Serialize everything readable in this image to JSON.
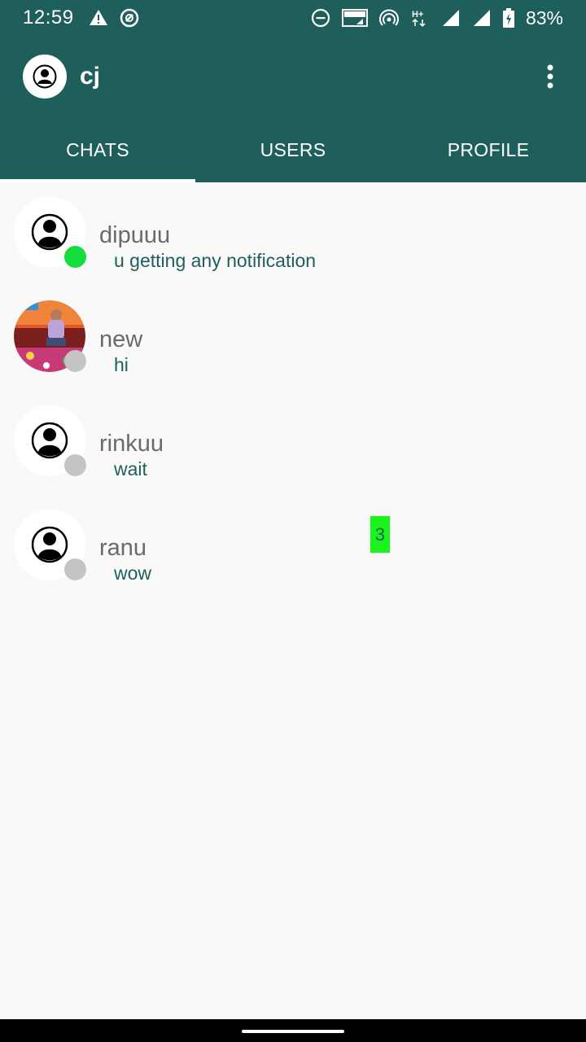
{
  "status_bar": {
    "time": "12:59",
    "battery": "83%",
    "left_icons": [
      "warning-icon",
      "no-disturb-icon"
    ],
    "right_icons": [
      "dnd-icon",
      "volte-icon",
      "hotspot-icon",
      "h-plus-icon",
      "signal-icon",
      "signal-icon",
      "battery-icon"
    ]
  },
  "app_bar": {
    "title": "cj",
    "menu_icon": "more-vert-icon"
  },
  "tabs": [
    {
      "label": "CHATS",
      "active": true
    },
    {
      "label": "USERS",
      "active": false
    },
    {
      "label": "PROFILE",
      "active": false
    }
  ],
  "chats": [
    {
      "name": "dipuuu",
      "last_message": "u getting any notification",
      "online": true,
      "avatar": "default-avatar-icon"
    },
    {
      "name": "new",
      "last_message": "hi",
      "online": false,
      "avatar": "photo"
    },
    {
      "name": "rinkuu",
      "last_message": "wait",
      "online": false,
      "avatar": "default-avatar-icon"
    },
    {
      "name": "ranu",
      "last_message": "wow",
      "online": false,
      "avatar": "default-avatar-icon"
    }
  ],
  "unread_badge": "3",
  "colors": {
    "primary": "#1f5f5b",
    "online": "#14dd3c",
    "offline": "#c4c4c4",
    "badge": "#19f51a"
  }
}
